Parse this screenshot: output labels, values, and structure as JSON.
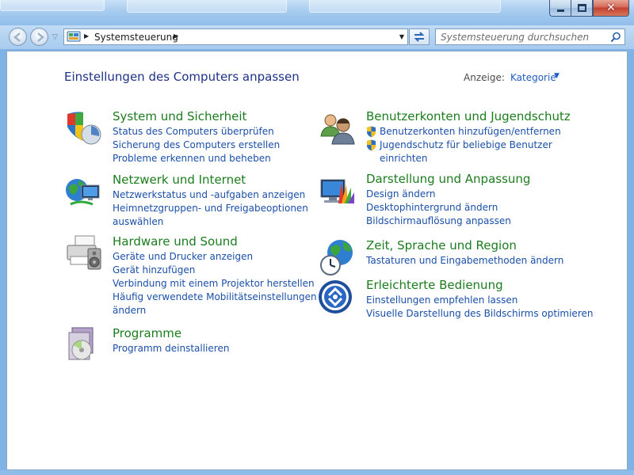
{
  "window": {
    "close_glyph": "✕"
  },
  "nav": {
    "address_path": "Systemsteuerung",
    "search_placeholder": "Systemsteuerung durchsuchen"
  },
  "main": {
    "title": "Einstellungen des Computers anpassen",
    "view_label": "Anzeige:",
    "view_value": "Kategorie"
  },
  "categories": [
    {
      "title": "System und Sicherheit",
      "icon": "system-security-icon",
      "links": [
        "Status des Computers überprüfen",
        "Sicherung des Computers erstellen",
        "Probleme erkennen und beheben"
      ]
    },
    {
      "title": "Netzwerk und Internet",
      "icon": "network-icon",
      "links": [
        "Netzwerkstatus und -aufgaben anzeigen",
        "Heimnetzgruppen- und Freigabeoptionen",
        "auswählen"
      ]
    },
    {
      "title": "Hardware und Sound",
      "icon": "hardware-sound-icon",
      "links": [
        "Geräte und Drucker anzeigen",
        "Gerät hinzufügen",
        "Verbindung mit einem Projektor herstellen",
        "Häufig verwendete Mobilitätseinstellungen",
        "ändern"
      ]
    },
    {
      "title": "Programme",
      "icon": "programs-icon",
      "links": [
        "Programm deinstallieren"
      ]
    },
    {
      "title": "Benutzerkonten und Jugendschutz",
      "icon": "user-accounts-icon",
      "links": [
        "Benutzerkonten hinzufügen/entfernen",
        "Jugendschutz für beliebige Benutzer",
        "einrichten"
      ]
    },
    {
      "title": "Darstellung und Anpassung",
      "icon": "appearance-icon",
      "links": [
        "Design ändern",
        "Desktophintergrund ändern",
        "Bildschirmauflösung anpassen"
      ]
    },
    {
      "title": "Zeit, Sprache und Region",
      "icon": "clock-language-region-icon",
      "links": [
        "Tastaturen und Eingabemethoden ändern"
      ]
    },
    {
      "title": "Erleichterte Bedienung",
      "icon": "ease-of-access-icon",
      "links": [
        "Einstellungen empfehlen lassen",
        "Visuelle Darstellung des Bildschirms optimieren"
      ]
    }
  ],
  "colors": {
    "category_title": "#1b7d1e",
    "link": "#1b4fa8",
    "page_title": "#1e3287"
  }
}
